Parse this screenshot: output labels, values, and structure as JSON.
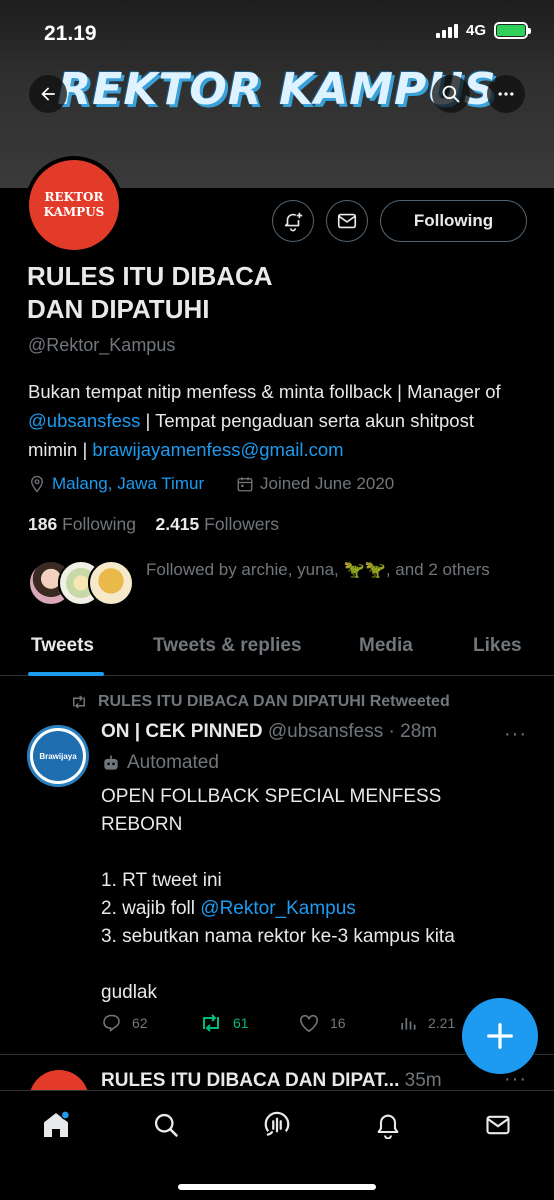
{
  "status": {
    "time": "21.19",
    "network": "4G"
  },
  "banner": {
    "title": "REKTOR KAMPUS"
  },
  "avatar": {
    "line1": "REKTOR",
    "line2": "KAMPUS"
  },
  "profile": {
    "follow_label": "Following",
    "display_name": "RULES ITU DIBACA\nDAN DIPATUHI",
    "handle": "@Rektor_Kampus",
    "bio": {
      "part1": "Bukan tempat nitip menfess & minta follback | Manager of ",
      "mention": "@ubsansfess",
      "part2": " | Tempat pengaduan serta akun shitpost mimin | ",
      "email": "brawijayamenfess@gmail.com"
    },
    "location": "Malang, Jawa Timur",
    "joined": "Joined June 2020",
    "following_count": "186",
    "following_label": "Following",
    "followers_count": "2.415",
    "followers_label": "Followers",
    "followed_by": "Followed by archie, yuna, 🦖🦖, and 2 others"
  },
  "tabs": [
    {
      "label": "Tweets"
    },
    {
      "label": "Tweets & replies"
    },
    {
      "label": "Media"
    },
    {
      "label": "Likes"
    }
  ],
  "tweet": {
    "retweet_text": "RULES ITU DIBACA DAN DIPATUHI Retweeted",
    "avatar_text": "Brawijaya",
    "name": "ON | CEK PINNED",
    "handle": "@ubsansfess",
    "time": "· 28m",
    "automated": "Automated",
    "line1": "OPEN FOLLBACK SPECIAL MENFESS",
    "line2": "REBORN",
    "item1": "1. RT tweet ini",
    "item2_prefix": "2. wajib foll ",
    "item2_mention": "@Rektor_Kampus",
    "item3": "3. sebutkan nama rektor ke-3 kampus kita",
    "closing": "gudlak",
    "replies": "62",
    "retweets": "61",
    "likes": "16",
    "views": "2.21"
  },
  "tweet2": {
    "name": "RULES ITU DIBACA DAN DIPAT...",
    "time": "35m"
  },
  "colors": {
    "accent": "#1d9bf0",
    "retweet": "#00ba7c",
    "avatar_red": "#e23b2a"
  },
  "icons": [
    "back-arrow-icon",
    "search-icon",
    "more-icon",
    "notification-bell-icon",
    "mail-icon",
    "location-pin-icon",
    "calendar-icon",
    "retweet-icon",
    "robot-icon",
    "reply-icon",
    "like-icon",
    "views-icon",
    "compose-plus-icon",
    "home-icon",
    "spaces-icon",
    "bell-icon"
  ]
}
